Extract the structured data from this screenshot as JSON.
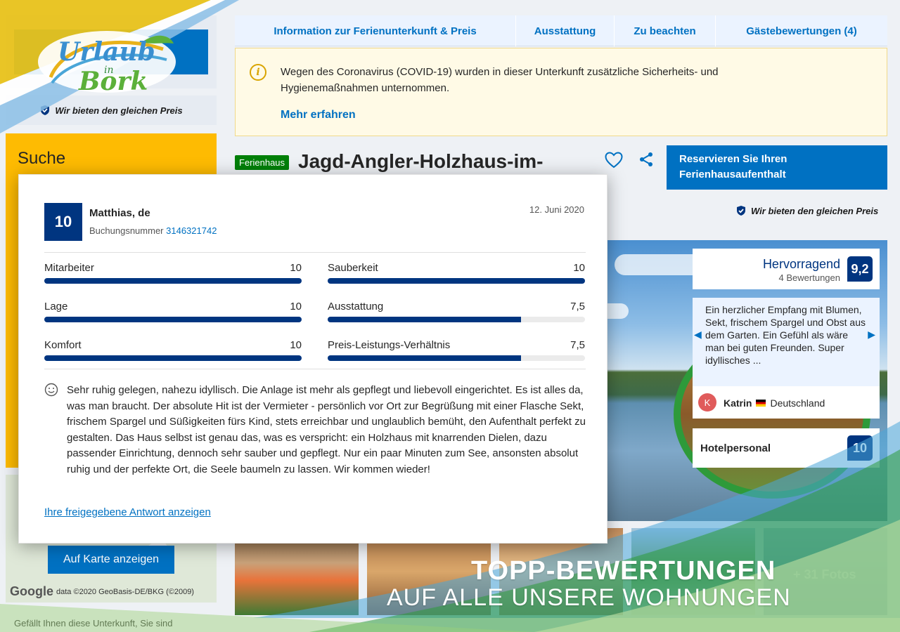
{
  "left": {
    "same_price": "Wir bieten den gleichen Preis",
    "search_title": "Suche",
    "map_button": "Auf Karte anzeigen",
    "map_credit": "data ©2020 GeoBasis-DE/BKG (©2009)",
    "map_logo": "Google",
    "bottom_text": "Gefällt Ihnen diese Unterkunft, Sie sind"
  },
  "nav": {
    "tabs": [
      {
        "label": "Information zur Ferienunterkunft & Preis"
      },
      {
        "label": "Ausstattung"
      },
      {
        "label": "Zu beachten"
      },
      {
        "label": "Gästebewertungen (4)"
      }
    ]
  },
  "covid": {
    "text": "Wegen des Coronavirus (COVID-19) wurden in dieser Unterkunft zusätzliche Sicherheits- und Hygienemaßnahmen unternommen.",
    "link": "Mehr erfahren"
  },
  "property": {
    "type_badge": "Ferienhaus",
    "title": "Jagd-Angler-Holzhaus-im-",
    "reserve_button": "Reservieren Sie Ihren Ferienhausaufenthalt",
    "same_price": "Wir bieten den gleichen Preis"
  },
  "rating": {
    "word": "Hervorragend",
    "count": "4 Bewertungen",
    "score": "9,2"
  },
  "quote": {
    "text": "Ein herzlicher Empfang mit Blumen, Sekt, frischem Spargel und Obst aus dem Garten. Ein Gefühl als wäre man bei guten Freunden. Super idyllisches ...",
    "avatar_letter": "K",
    "author": "Katrin",
    "country": "Deutschland"
  },
  "staff": {
    "label": "Hotelpersonal",
    "score": "10"
  },
  "photos": {
    "more": "+ 31 Fotos"
  },
  "review": {
    "score": "10",
    "name": "Matthias, de",
    "booking_label": "Buchungsnummer",
    "booking_number": "3146321742",
    "date": "12. Juni 2020",
    "criteria": [
      {
        "label": "Mitarbeiter",
        "value": "10",
        "fraction": 1.0
      },
      {
        "label": "Sauberkeit",
        "value": "10",
        "fraction": 1.0
      },
      {
        "label": "Lage",
        "value": "10",
        "fraction": 1.0
      },
      {
        "label": "Ausstattung",
        "value": "7,5",
        "fraction": 0.75
      },
      {
        "label": "Komfort",
        "value": "10",
        "fraction": 1.0
      },
      {
        "label": "Preis-Leistungs-Verhältnis",
        "value": "7,5",
        "fraction": 0.75
      }
    ],
    "text": "Sehr ruhig gelegen, nahezu idyllisch. Die Anlage ist mehr als gepflegt und liebevoll eingerichtet. Es ist alles da, was man braucht. Der absolute Hit ist der Vermieter - persönlich vor Ort zur Begrüßung mit einer Flasche Sekt, frischem Spargel und Süßigkeiten fürs Kind, stets erreichbar und unglaublich bemüht, den Aufenthalt perfekt zu gestalten. Das Haus selbst ist genau das, was es verspricht: ein Holzhaus mit knarrenden Dielen, dazu passender Einrichtung, dennoch sehr sauber und gepflegt. Nur ein paar Minuten zum See, ansonsten absolut ruhig und der perfekte Ort, die Seele baumeln zu lassen. Wir kommen wieder!",
    "link": "Ihre freigegebene Antwort anzeigen"
  },
  "promo": {
    "line1": "TOPP-BEWERTUNGEN",
    "line2": "AUF ALLE UNSERE WOHNUNGEN"
  },
  "logo": {
    "line1": "Urlaub",
    "mid": "in",
    "line2": "Bork"
  },
  "colors": {
    "brand_blue": "#0071c2",
    "dark_blue": "#003580",
    "search_yellow": "#febb02",
    "green": "#008009"
  }
}
